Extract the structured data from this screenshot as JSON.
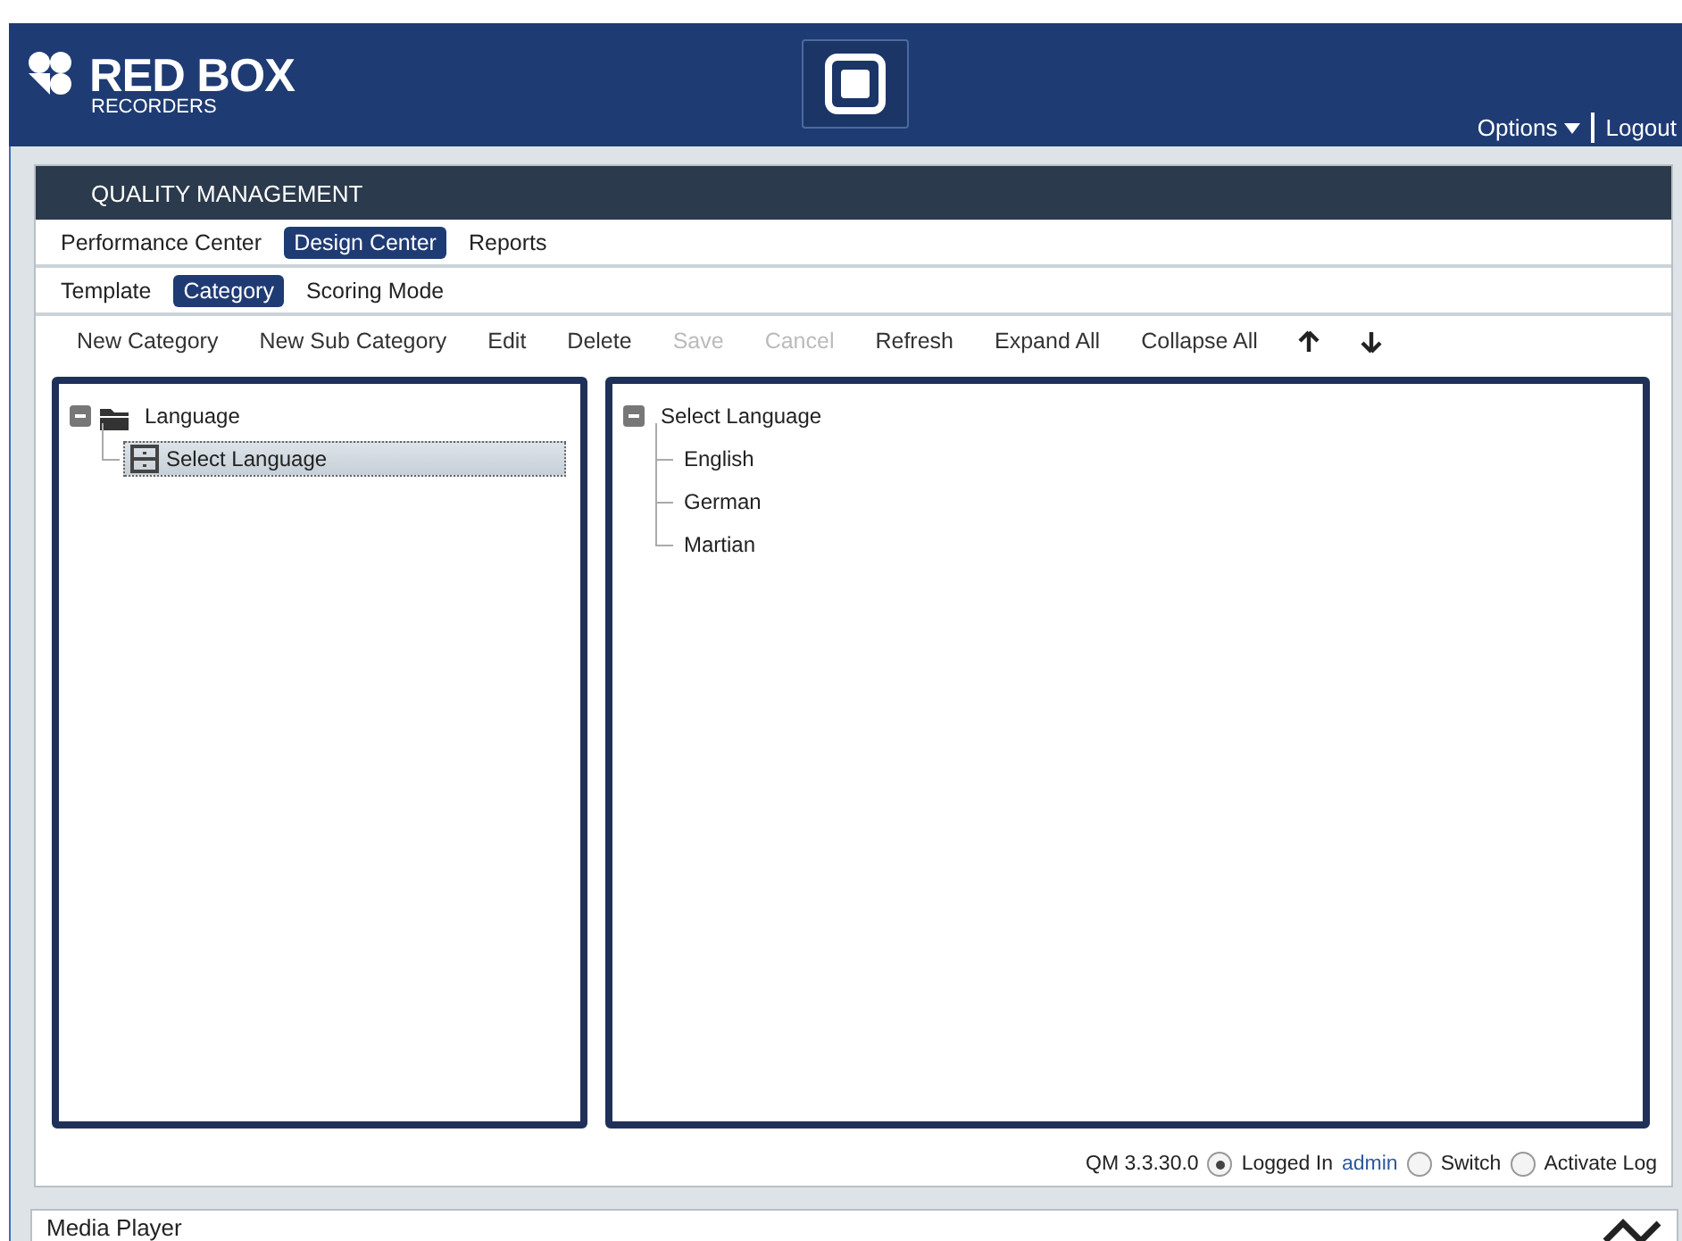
{
  "brand": {
    "name": "RED BOX",
    "sub": "RECORDERS"
  },
  "header_links": [
    {
      "kind": "menu",
      "label": "Options"
    },
    {
      "kind": "link",
      "label": "Logout"
    }
  ],
  "panel_title": "QUALITY MANAGEMENT",
  "tabs": [
    {
      "label": "Performance Center",
      "selected": false
    },
    {
      "label": "Design Center",
      "selected": true
    },
    {
      "label": "Reports",
      "selected": false
    }
  ],
  "subtabs": [
    {
      "label": "Template",
      "selected": false
    },
    {
      "label": "Category",
      "selected": true
    },
    {
      "label": "Scoring Mode",
      "selected": false
    }
  ],
  "toolbar": [
    {
      "kind": "text",
      "label": "New Category",
      "disabled": false
    },
    {
      "kind": "text",
      "label": "New Sub Category",
      "disabled": false
    },
    {
      "kind": "text",
      "label": "Edit",
      "disabled": false
    },
    {
      "kind": "text",
      "label": "Delete",
      "disabled": false
    },
    {
      "kind": "text",
      "label": "Save",
      "disabled": true
    },
    {
      "kind": "text",
      "label": "Cancel",
      "disabled": true
    },
    {
      "kind": "text",
      "label": "Refresh",
      "disabled": false
    },
    {
      "kind": "text",
      "label": "Expand All",
      "disabled": false
    },
    {
      "kind": "text",
      "label": "Collapse All",
      "disabled": false
    },
    {
      "kind": "up",
      "disabled": false
    },
    {
      "kind": "down",
      "disabled": false
    }
  ],
  "left_tree": [
    {
      "label": "Language",
      "kind": "folder",
      "expanded": true,
      "selected": false,
      "children": [
        {
          "label": "Select Language",
          "kind": "drawer",
          "selected": true
        }
      ]
    }
  ],
  "right_tree": [
    {
      "label": "Select Language",
      "expanded": true,
      "children": [
        {
          "label": "English"
        },
        {
          "label": "German"
        },
        {
          "label": "Martian"
        }
      ]
    }
  ],
  "status": [
    {
      "kind": "text",
      "label": "QM 3.3.30.0"
    },
    {
      "kind": "radio",
      "label": "Logged In",
      "selected": true
    },
    {
      "kind": "link",
      "label": "admin"
    },
    {
      "kind": "radio",
      "label": "Switch",
      "selected": false
    },
    {
      "kind": "radio",
      "label": "Activate Log",
      "selected": false
    }
  ],
  "media_player": {
    "title": "Media Player"
  }
}
